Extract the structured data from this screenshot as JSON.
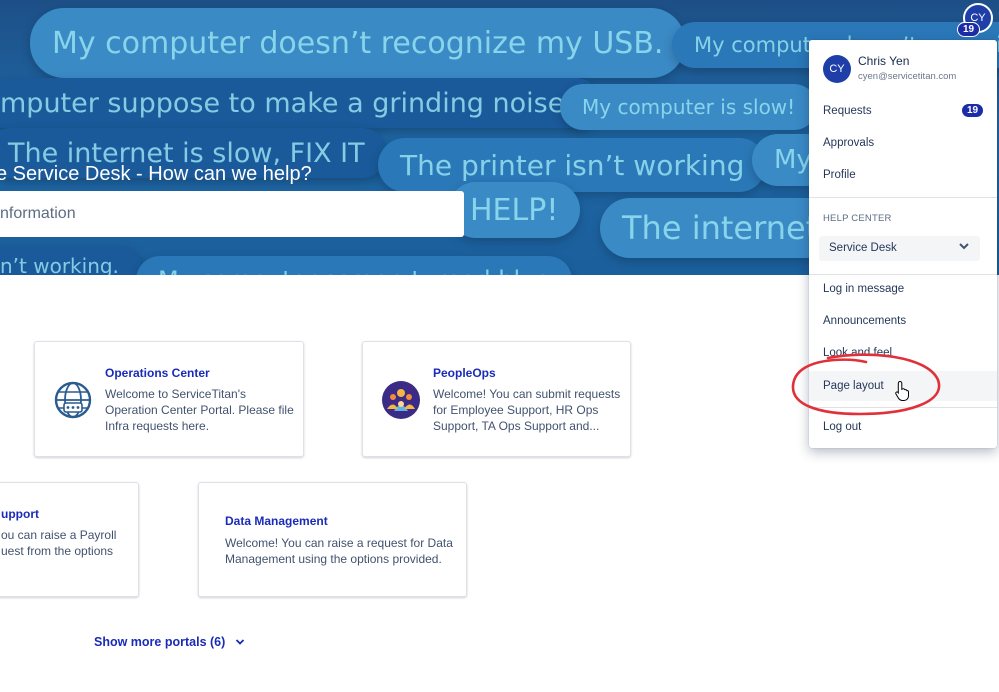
{
  "banner": {
    "bubbles": [
      "My computer doesn’t recognize my USB.",
      "My computer doesn’t recogni",
      "mputer suppose to make a grinding noise?",
      "My computer is slow!",
      "The internet is slow, FIX IT",
      "The printer isn’t working",
      "My",
      "HELP!",
      "The internet",
      "n’t working.",
      "My computer screen turned blue"
    ],
    "title": "e Service Desk - How can we help?",
    "search_placeholder": "nformation"
  },
  "header": {
    "avatar_initials": "CY",
    "badge_count": "19"
  },
  "portals": [
    {
      "title": "Operations Center",
      "desc_lines": [
        "Welcome to ServiceTitan's",
        "Operation Center Portal. Please file",
        "Infra requests here."
      ],
      "icon": "globe-network-icon"
    },
    {
      "title": "PeopleOps",
      "desc_lines": [
        "Welcome! You can submit requests",
        "for Employee Support, HR Ops",
        "Support, TA Ops Support and..."
      ],
      "icon": "people-team-icon"
    },
    {
      "title": "upport",
      "desc_lines": [
        "ou can raise a Payroll",
        "uest from the options"
      ],
      "icon": ""
    },
    {
      "title": "Data Management",
      "desc_lines": [
        "Welcome! You can raise a request for Data",
        "Management using the options provided."
      ],
      "icon": ""
    }
  ],
  "show_more": "Show more portals (6)",
  "menu": {
    "user": {
      "initials": "CY",
      "name": "Chris Yen",
      "email": "cyen@servicetitan.com"
    },
    "items": [
      {
        "label": "Requests",
        "badge": "19"
      },
      {
        "label": "Approvals"
      },
      {
        "label": "Profile"
      }
    ],
    "help_center_label": "HELP CENTER",
    "help_center_select": "Service Desk",
    "admin_items": [
      {
        "label": "Log in message"
      },
      {
        "label": "Announcements"
      },
      {
        "label": "Look and feel"
      },
      {
        "label": "Page layout"
      }
    ],
    "logout": "Log out"
  },
  "colors": {
    "brand": "#1a2bb8",
    "badge": "#1c2ca8",
    "annotation": "#e0303a"
  }
}
